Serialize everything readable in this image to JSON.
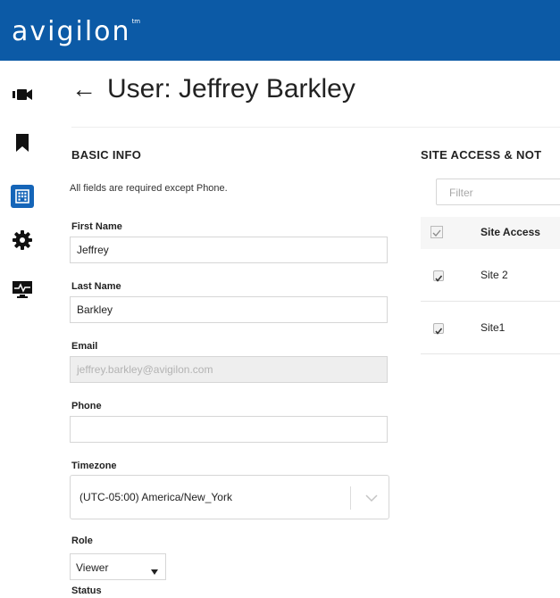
{
  "brand": {
    "name": "avigilon",
    "tm": "TM"
  },
  "nav": {
    "items": [
      "camera-icon",
      "bookmark-icon",
      "building-icon",
      "gear-icon",
      "monitor-health-icon"
    ],
    "active": "building-icon"
  },
  "header": {
    "back_icon": "←",
    "title": "User: Jeffrey Barkley"
  },
  "basic_info": {
    "title": "BASIC INFO",
    "note": "All fields are required except Phone.",
    "first_name": {
      "label": "First Name",
      "value": "Jeffrey"
    },
    "last_name": {
      "label": "Last Name",
      "value": "Barkley"
    },
    "email": {
      "label": "Email",
      "value": "jeffrey.barkley@avigilon.com"
    },
    "phone": {
      "label": "Phone",
      "value": ""
    },
    "timezone": {
      "label": "Timezone",
      "value": "(UTC-05:00) America/New_York"
    },
    "role": {
      "label": "Role",
      "value": "Viewer"
    },
    "status": {
      "label": "Status"
    }
  },
  "site_access": {
    "title": "SITE ACCESS & NOT",
    "filter_placeholder": "Filter",
    "column": "Site Access",
    "rows": [
      {
        "name": "Site 2",
        "checked": true
      },
      {
        "name": "Site1",
        "checked": true
      }
    ]
  },
  "colors": {
    "topbar": "#0c5aa6",
    "active_nav": "#1565b8"
  }
}
